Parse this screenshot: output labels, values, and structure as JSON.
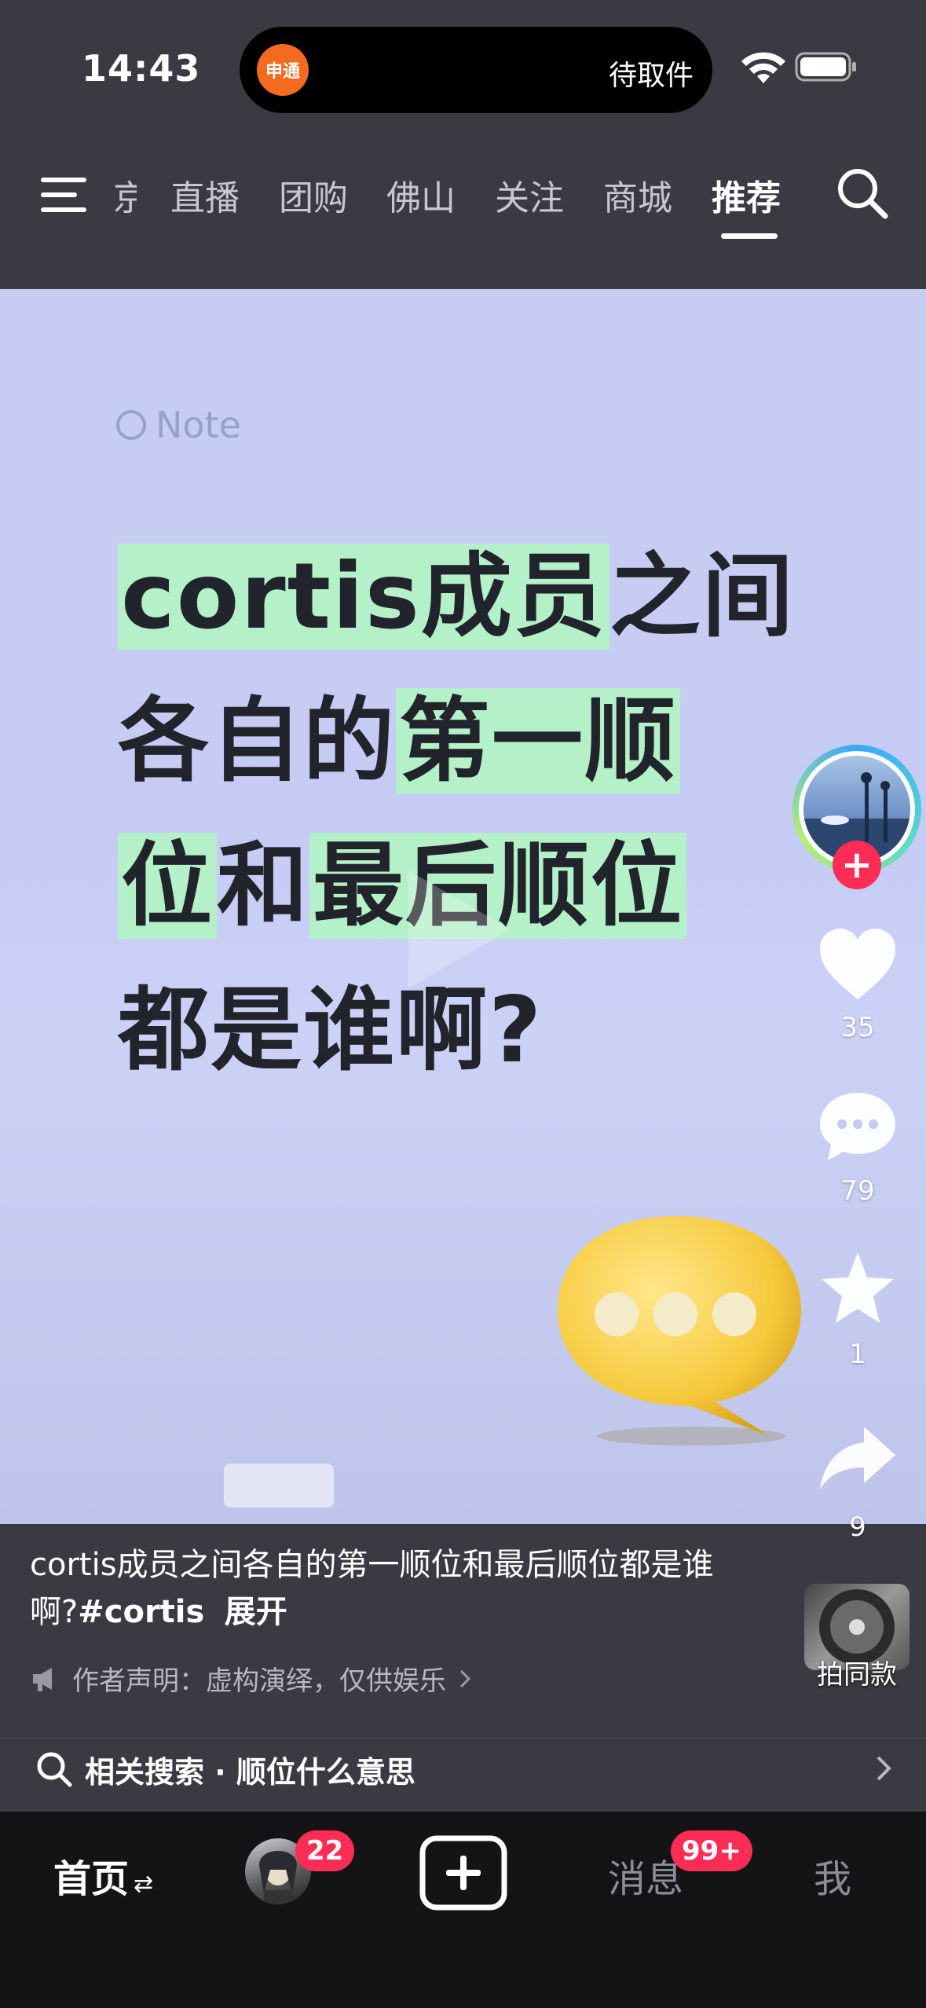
{
  "status_bar": {
    "time": "14:43",
    "island_app": "申通",
    "island_status": "待取件",
    "icons": [
      "wifi-icon",
      "battery-icon"
    ]
  },
  "top_nav": {
    "partial_tab": "京",
    "tabs": [
      "直播",
      "团购",
      "佛山",
      "关注",
      "商城",
      "推荐"
    ],
    "active_tab": "推荐",
    "icons": [
      "menu-icon",
      "search-icon"
    ]
  },
  "video": {
    "watermark": "Note",
    "headline_lines": [
      {
        "marked": "cortis成员",
        "rest": "之间"
      },
      {
        "plain": "各自的",
        "marked": "第一顺"
      },
      {
        "marked": "位",
        "plain": "和",
        "marked2": "最后顺位"
      },
      {
        "plain": "都是谁啊?"
      }
    ]
  },
  "actions": {
    "likes": "35",
    "comments": "79",
    "favorites": "1",
    "shares": "9",
    "follow_symbol": "+",
    "icons": [
      "heart-icon",
      "comment-icon",
      "star-icon",
      "share-icon"
    ]
  },
  "caption": {
    "text": "cortis成员之间各自的第一顺位和最后顺位都是谁啊?",
    "hashtag": "#cortis",
    "expand": "展开",
    "declaration": "作者声明：虚构演绎，仅供娱乐",
    "same_style": "拍同款"
  },
  "related": {
    "label": "相关搜索 · 顺位什么意思"
  },
  "bottom_nav": {
    "home": "首页",
    "home_symbol": "⇄",
    "friends_badge": "22",
    "messages": "消息",
    "messages_badge": "99+",
    "me": "我",
    "accent": "#ff2c55"
  }
}
